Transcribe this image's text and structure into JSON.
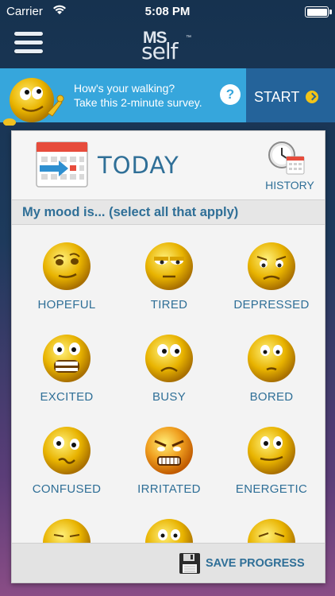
{
  "status_bar": {
    "carrier": "Carrier",
    "time": "5:08 PM"
  },
  "nav": {
    "logo_ms": "MS",
    "logo_self": "self",
    "logo_tm": "™"
  },
  "survey": {
    "line1": "How's your walking?",
    "line2": "Take this 2-minute survey.",
    "help": "?",
    "start_label": "START"
  },
  "card": {
    "title": "TODAY",
    "history_label": "HISTORY",
    "mood_prompt": "My mood is... (select all that apply)",
    "moods": [
      {
        "label": "HOPEFUL"
      },
      {
        "label": "TIRED"
      },
      {
        "label": "DEPRESSED"
      },
      {
        "label": "EXCITED"
      },
      {
        "label": "BUSY"
      },
      {
        "label": "BORED"
      },
      {
        "label": "CONFUSED"
      },
      {
        "label": "IRRITATED"
      },
      {
        "label": "ENERGETIC"
      }
    ],
    "save_label": "SAVE PROGRESS"
  },
  "colors": {
    "accent_blue": "#2f6f97",
    "banner_light": "#36a6dc",
    "banner_dark": "#24639a",
    "start_arrow": "#f2c418"
  }
}
